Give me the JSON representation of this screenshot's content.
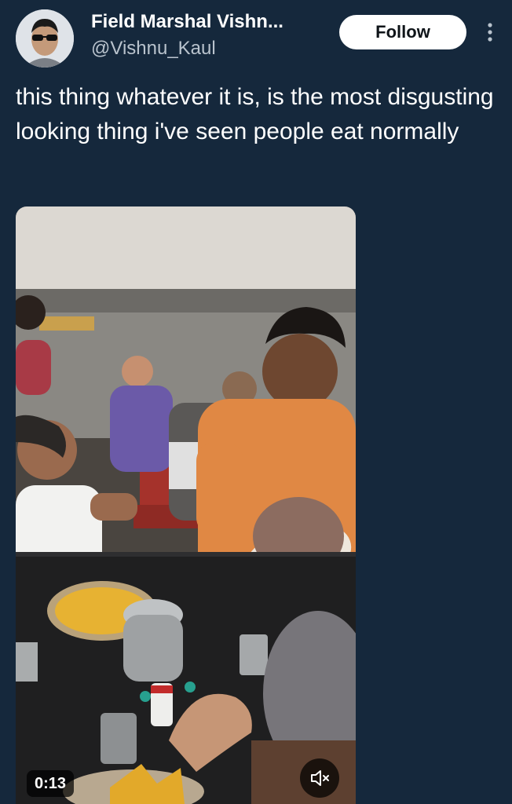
{
  "author": {
    "display_name": "Field Marshal Vishn...",
    "handle": "@Vishnu_Kaul",
    "avatar_icon": "avatar-icon"
  },
  "actions": {
    "follow_label": "Follow",
    "more_icon": "more-vertical-icon"
  },
  "tweet": {
    "text": "this thing whatever it is, is the most disgusting looking thing i've seen people eat normally"
  },
  "video": {
    "timestamp": "0:13",
    "mute_icon": "volume-muted-icon"
  },
  "colors": {
    "background": "#15283c",
    "text_primary": "#ffffff",
    "text_secondary": "#b9c3cd",
    "button_bg": "#ffffff",
    "button_text": "#0f1419"
  }
}
